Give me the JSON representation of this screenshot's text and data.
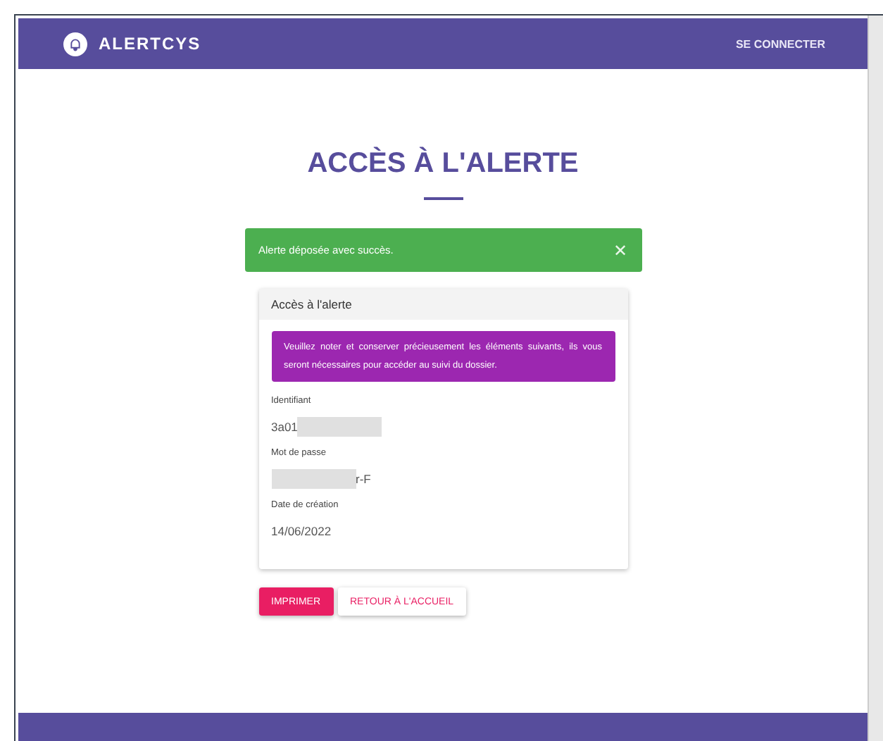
{
  "header": {
    "brand": "ALERTCYS",
    "login_link": "SE CONNECTER"
  },
  "title": "ACCÈS À L'ALERTE",
  "alert": {
    "message": "Alerte déposée avec succès.",
    "close": "✕"
  },
  "card": {
    "title": "Accès à l'alerte",
    "notice": "Veuillez noter et conserver précieusement les éléments suivants, ils vous seront nécessaires pour accéder au suivi du dossier.",
    "fields": [
      {
        "label": "Identifiant",
        "before": "3a01",
        "redacted": true
      },
      {
        "label": "Mot de passe",
        "redacted": true,
        "after": "r-F"
      },
      {
        "label": "Date de création",
        "before": "14/06/2022",
        "redacted": false
      }
    ]
  },
  "buttons": [
    {
      "label": "IMPRIMER",
      "kind": "primary"
    },
    {
      "label": "RETOUR À L'ACCUEIL",
      "kind": "secondary"
    }
  ]
}
